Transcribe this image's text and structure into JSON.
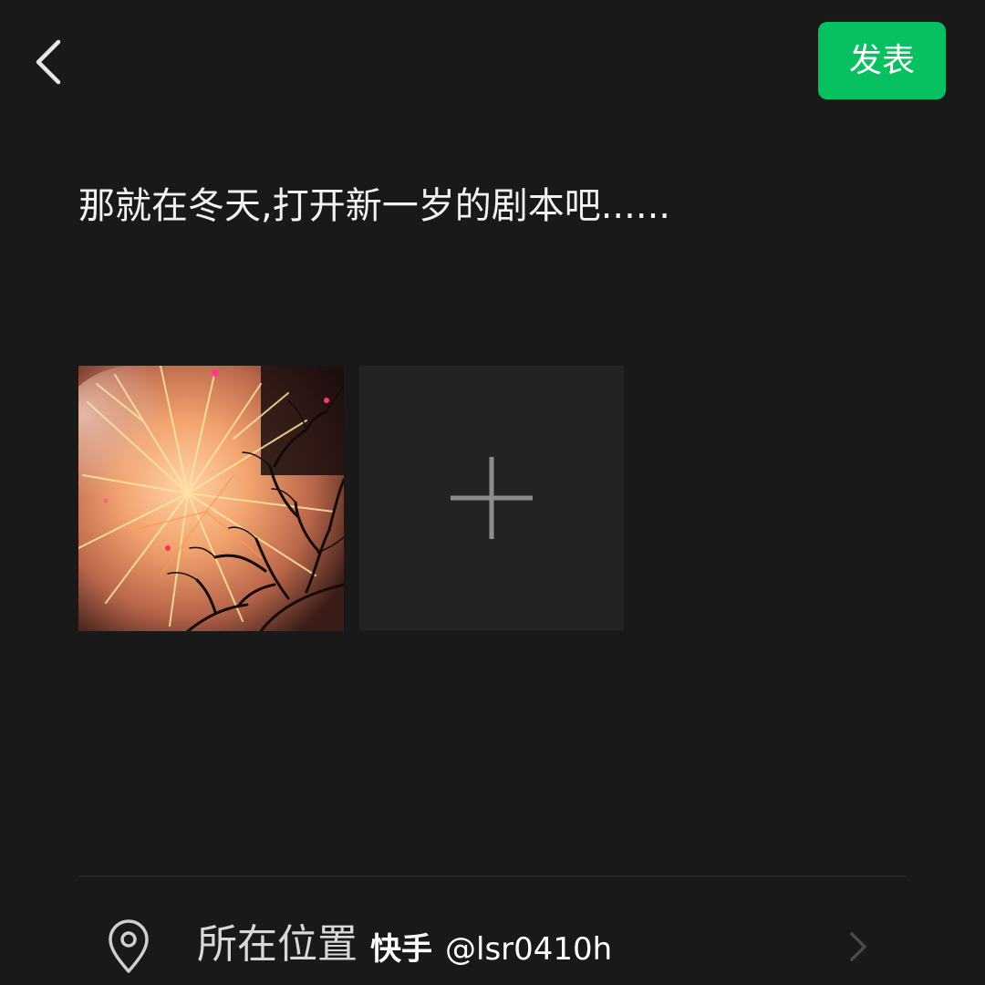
{
  "header": {
    "back_icon": "chevron-left-icon",
    "publish_label": "发表",
    "publish_color": "#07c160"
  },
  "post": {
    "text": "那就在冬天,打开新一岁的剧本吧......"
  },
  "media": {
    "photos": [
      {
        "alt": "fireworks-photo"
      }
    ],
    "add_icon": "plus-icon"
  },
  "options": {
    "location": {
      "icon": "location-pin-icon",
      "label": "所在位置"
    }
  },
  "watermark": {
    "brand": "快手",
    "handle": "@lsr0410h"
  }
}
